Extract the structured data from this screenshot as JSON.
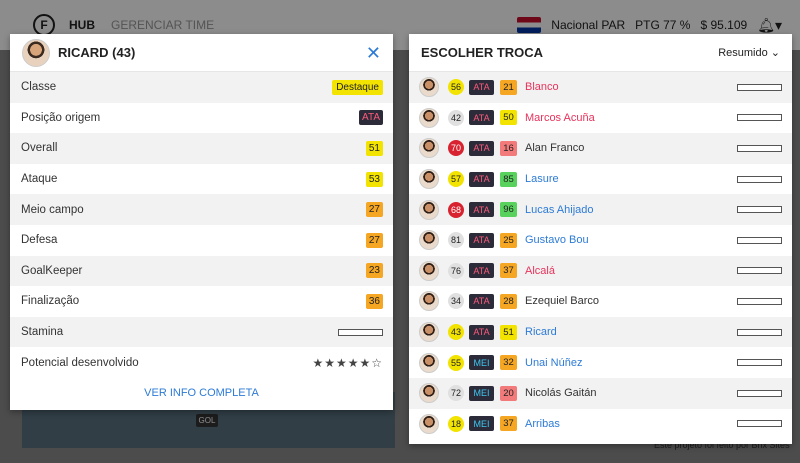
{
  "topbar": {
    "hub": "HUB",
    "manage": "GERENCIAR TIME",
    "club": "Nacional PAR",
    "ptg": "PTG 77 %",
    "money": "$ 95.109"
  },
  "field": {
    "gol": "GOL"
  },
  "footer_note": "Este projeto foi feito por Brix Sites",
  "player_card": {
    "title": "RICARD (43)",
    "attributes": [
      {
        "label": "Classe",
        "value": "Destaque",
        "style": "destaque"
      },
      {
        "label": "Posição origem",
        "value": "ATA",
        "style": "dark"
      },
      {
        "label": "Overall",
        "value": "51",
        "style": "yellow"
      },
      {
        "label": "Ataque",
        "value": "53",
        "style": "yellow"
      },
      {
        "label": "Meio campo",
        "value": "27",
        "style": "orange"
      },
      {
        "label": "Defesa",
        "value": "27",
        "style": "orange"
      },
      {
        "label": "GoalKeeper",
        "value": "23",
        "style": "orange"
      },
      {
        "label": "Finalização",
        "value": "36",
        "style": "orange"
      }
    ],
    "stamina_label": "Stamina",
    "potential_label": "Potencial desenvolvido",
    "potential_stars": "★★★★★☆",
    "see_more": "VER INFO COMPLETA"
  },
  "swap_card": {
    "title": "ESCOLHER TROCA",
    "view": "Resumido",
    "players": [
      {
        "ovr": "56",
        "ovr_color": "yellow",
        "pos": "ATA",
        "att": "21",
        "att_color": "orange",
        "name": "Blanco",
        "name_color": "pink"
      },
      {
        "ovr": "42",
        "ovr_color": "gray",
        "pos": "ATA",
        "att": "50",
        "att_color": "yellow",
        "name": "Marcos Acuña",
        "name_color": "pink"
      },
      {
        "ovr": "70",
        "ovr_color": "red",
        "pos": "ATA",
        "att": "16",
        "att_color": "red",
        "name": "Alan Franco",
        "name_color": "dark"
      },
      {
        "ovr": "57",
        "ovr_color": "yellow",
        "pos": "ATA",
        "att": "85",
        "att_color": "green",
        "name": "Lasure",
        "name_color": "blue"
      },
      {
        "ovr": "68",
        "ovr_color": "red",
        "pos": "ATA",
        "att": "96",
        "att_color": "green",
        "name": "Lucas Ahijado",
        "name_color": "blue"
      },
      {
        "ovr": "81",
        "ovr_color": "gray",
        "pos": "ATA",
        "att": "25",
        "att_color": "orange",
        "name": "Gustavo Bou",
        "name_color": "blue"
      },
      {
        "ovr": "76",
        "ovr_color": "gray",
        "pos": "ATA",
        "att": "37",
        "att_color": "orange",
        "name": "Alcalá",
        "name_color": "pink"
      },
      {
        "ovr": "34",
        "ovr_color": "gray",
        "pos": "ATA",
        "att": "28",
        "att_color": "orange",
        "name": "Ezequiel Barco",
        "name_color": "dark"
      },
      {
        "ovr": "43",
        "ovr_color": "yellow",
        "pos": "ATA",
        "att": "51",
        "att_color": "yellow",
        "name": "Ricard",
        "name_color": "blue"
      },
      {
        "ovr": "55",
        "ovr_color": "yellow",
        "pos": "MEI",
        "att": "32",
        "att_color": "orange",
        "name": "Unai Núñez",
        "name_color": "blue"
      },
      {
        "ovr": "72",
        "ovr_color": "gray",
        "pos": "MEI",
        "att": "20",
        "att_color": "red",
        "name": "Nicolás Gaitán",
        "name_color": "dark"
      },
      {
        "ovr": "18",
        "ovr_color": "yellow",
        "pos": "MEI",
        "att": "37",
        "att_color": "orange",
        "name": "Arribas",
        "name_color": "blue"
      }
    ]
  }
}
